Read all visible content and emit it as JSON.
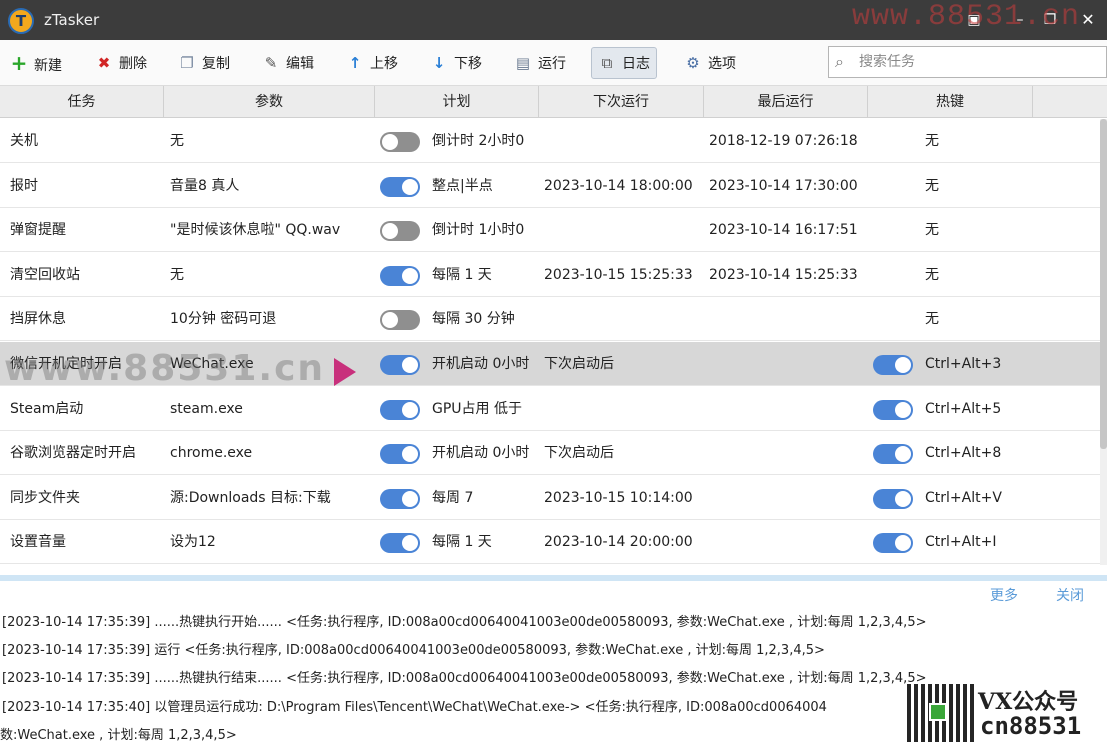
{
  "window": {
    "app_icon_letter": "T",
    "title": "zTasker",
    "menu_glyph": "▣",
    "min_glyph": "–",
    "max_glyph": "❐",
    "close_glyph": "✕"
  },
  "toolbar": {
    "new": "新建",
    "delete": "删除",
    "copy": "复制",
    "edit": "编辑",
    "move_up": "上移",
    "move_down": "下移",
    "run": "运行",
    "log": "日志",
    "options": "选项",
    "search_placeholder": "搜索任务"
  },
  "table": {
    "headers": [
      "任务",
      "参数",
      "计划",
      "下次运行",
      "最后运行",
      "热键"
    ],
    "rows": [
      {
        "task": "关机",
        "param": "无",
        "sched_on": false,
        "schedule": "倒计时 2小时0",
        "next": "",
        "last": "2018-12-19 07:26:18",
        "hot_toggle": false,
        "hotkey": "无"
      },
      {
        "task": "报时",
        "param": "音量8 真人",
        "sched_on": true,
        "schedule": "整点|半点",
        "next": "2023-10-14 18:00:00",
        "last": "2023-10-14 17:30:00",
        "hot_toggle": false,
        "hotkey": "无"
      },
      {
        "task": "弹窗提醒",
        "param": "\"是时候该休息啦\" QQ.wav",
        "sched_on": false,
        "schedule": "倒计时 1小时0",
        "next": "",
        "last": "2023-10-14 16:17:51",
        "hot_toggle": false,
        "hotkey": "无"
      },
      {
        "task": "清空回收站",
        "param": "无",
        "sched_on": true,
        "schedule": "每隔 1 天",
        "next": "2023-10-15 15:25:33",
        "last": "2023-10-14 15:25:33",
        "hot_toggle": false,
        "hotkey": "无"
      },
      {
        "task": "挡屏休息",
        "param": "10分钟 密码可退",
        "sched_on": false,
        "schedule": "每隔 30 分钟",
        "next": "",
        "last": "",
        "hot_toggle": false,
        "hotkey": "无"
      },
      {
        "task": "微信开机定时开启",
        "param": "WeChat.exe",
        "sched_on": true,
        "schedule": "开机启动 0小时",
        "next": "下次启动后",
        "last": "",
        "hot_toggle": true,
        "hotkey": "Ctrl+Alt+3"
      },
      {
        "task": "Steam启动",
        "param": "steam.exe",
        "sched_on": true,
        "schedule": "GPU占用 低于",
        "next": "",
        "last": "",
        "hot_toggle": true,
        "hotkey": "Ctrl+Alt+5"
      },
      {
        "task": "谷歌浏览器定时开启",
        "param": "chrome.exe",
        "sched_on": true,
        "schedule": "开机启动 0小时",
        "next": "下次启动后",
        "last": "",
        "hot_toggle": true,
        "hotkey": "Ctrl+Alt+8"
      },
      {
        "task": "同步文件夹",
        "param": "源:Downloads 目标:下载",
        "sched_on": true,
        "schedule": "每周 7",
        "next": "2023-10-15 10:14:00",
        "last": "",
        "hot_toggle": true,
        "hotkey": "Ctrl+Alt+V"
      },
      {
        "task": "设置音量",
        "param": "设为12",
        "sched_on": true,
        "schedule": "每隔 1 天",
        "next": "2023-10-14 20:00:00",
        "last": "",
        "hot_toggle": true,
        "hotkey": "Ctrl+Alt+I"
      }
    ]
  },
  "log": {
    "more": "更多",
    "close": "关闭",
    "lines": [
      "[2023-10-14 17:35:39] ......热键执行开始...... <任务:执行程序, ID:008a00cd00640041003e00de00580093, 参数:WeChat.exe , 计划:每周 1,2,3,4,5>",
      "[2023-10-14 17:35:39] 运行 <任务:执行程序, ID:008a00cd00640041003e00de00580093, 参数:WeChat.exe , 计划:每周 1,2,3,4,5>",
      "[2023-10-14 17:35:39] ......热键执行结束...... <任务:执行程序, ID:008a00cd00640041003e00de00580093, 参数:WeChat.exe , 计划:每周 1,2,3,4,5>",
      "[2023-10-14 17:35:40] 以管理员运行成功: D:\\Program Files\\Tencent\\WeChat\\WeChat.exe-> <任务:执行程序, ID:008a00cd0064004",
      "数:WeChat.exe , 计划:每周 1,2,3,4,5>"
    ]
  },
  "watermarks": {
    "top": "www.88531.cn",
    "mid": "www.88531.cn",
    "vx": "VX公众号",
    "cn": "cn88531"
  }
}
